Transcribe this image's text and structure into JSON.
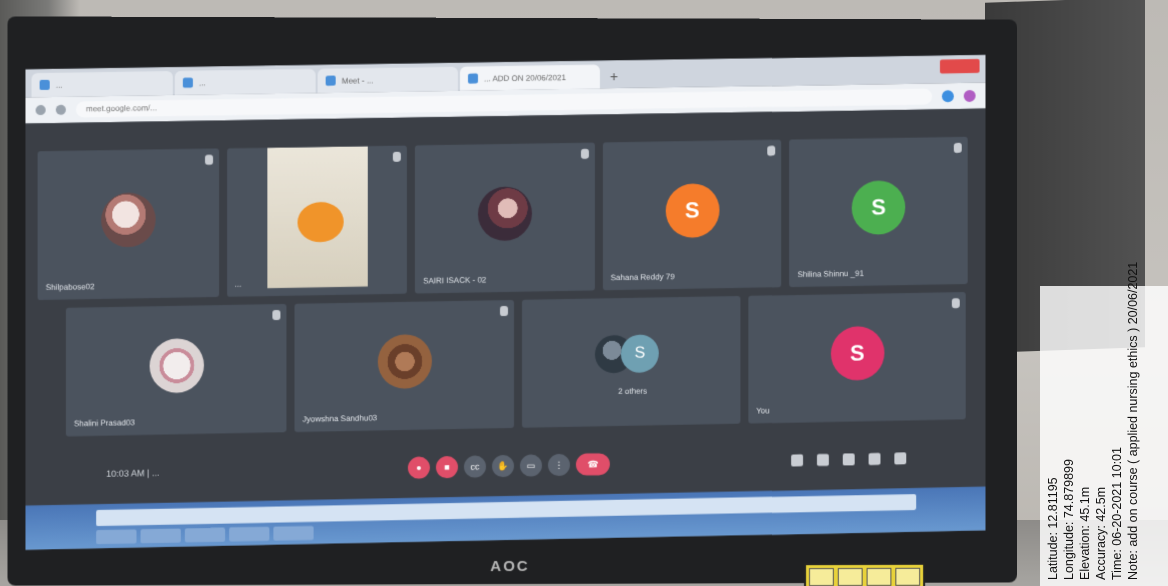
{
  "browser": {
    "tabs": [
      {
        "label": "...",
        "active": false
      },
      {
        "label": "...",
        "active": false
      },
      {
        "label": "Meet - ...",
        "active": false
      },
      {
        "label": "... ADD ON 20/06/2021",
        "active": true
      }
    ],
    "new_tab_symbol": "+",
    "url": "meet.google.com/..."
  },
  "meet": {
    "row1": [
      {
        "name": "Shilpabose02",
        "avatar": "photo",
        "letter": ""
      },
      {
        "name": "...",
        "avatar": "poster",
        "letter": ""
      },
      {
        "name": "SAIRI ISACK - 02",
        "avatar": "photo2",
        "letter": ""
      },
      {
        "name": "Sahana Reddy 79",
        "avatar": "letter",
        "letter": "S",
        "color": "#f57c2b"
      },
      {
        "name": "Shilina Shinnu _91",
        "avatar": "letter",
        "letter": "S",
        "color": "#4caf50"
      }
    ],
    "row2": [
      {
        "name": "Shalini Prasad03",
        "avatar": "photo3",
        "letter": ""
      },
      {
        "name": "Jyowshna Sandhu03",
        "avatar": "photo4",
        "letter": ""
      },
      {
        "name": "2 others",
        "avatar": "group",
        "letter": "S"
      },
      {
        "name": "You",
        "avatar": "letter",
        "letter": "S",
        "color": "#e0336b"
      }
    ],
    "meeting_title": "10:03 AM  |  ...",
    "control_icons": [
      "mic-off-icon",
      "camera-off-icon",
      "captions-icon",
      "raise-hand-icon",
      "present-icon",
      "more-icon",
      "end-call-icon"
    ],
    "side_icons": [
      "info-icon",
      "people-icon",
      "chat-icon",
      "activities-icon",
      "shield-icon"
    ]
  },
  "monitor": {
    "brand": "AOC"
  },
  "geotag": {
    "lines": [
      "Latitude: 12.81195",
      "Longitude: 74.879899",
      "Elevation: 45.1m",
      "Accuracy: 42.5m",
      "Time: 06-20-2021 10:01",
      "Note: add on course ( applied nursing ethics ) 20/06/2021"
    ]
  },
  "colors": {
    "end_call": "#e04e69",
    "orange_avatar": "#f57c2b",
    "green_avatar": "#4caf50",
    "pink_avatar": "#e0336b"
  }
}
